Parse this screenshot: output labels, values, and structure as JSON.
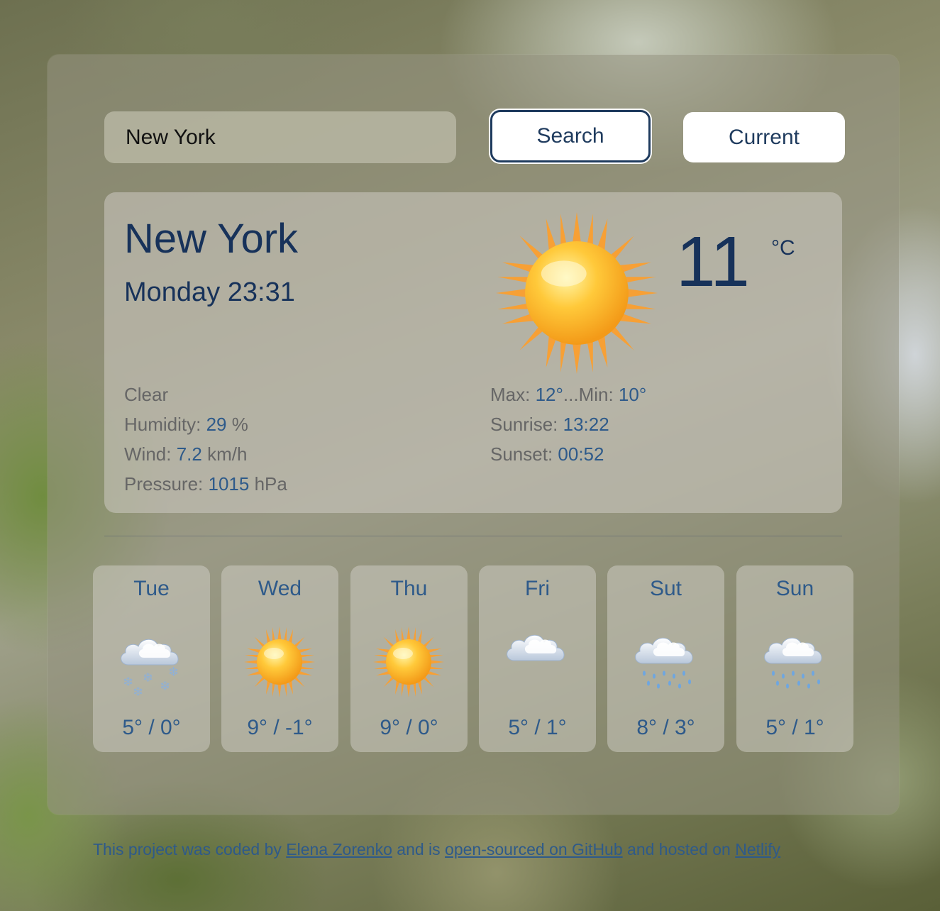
{
  "search": {
    "value": "New York",
    "search_label": "Search",
    "current_label": "Current"
  },
  "current": {
    "city": "New York",
    "datetime": "Monday 23:31",
    "description": "Clear",
    "humidity_label": "Humidity: ",
    "humidity_value": "29",
    "humidity_unit": " %",
    "wind_label": "Wind: ",
    "wind_value": "7.2",
    "wind_unit": " km/h",
    "pressure_label": "Pressure: ",
    "pressure_value": "1015",
    "pressure_unit": " hPa",
    "max_label": "Max: ",
    "max_value": "12°",
    "min_label": "...Min: ",
    "min_value": "10°",
    "sunrise_label": "Sunrise: ",
    "sunrise_value": "13:22",
    "sunset_label": "Sunset: ",
    "sunset_value": "00:52",
    "temperature": "11",
    "unit": "°C",
    "icon": "sun-icon"
  },
  "forecast": [
    {
      "day": "Tue",
      "temps": "5° / 0°",
      "icon": "snow-icon"
    },
    {
      "day": "Wed",
      "temps": "9° / -1°",
      "icon": "sun-icon"
    },
    {
      "day": "Thu",
      "temps": "9° / 0°",
      "icon": "sun-icon"
    },
    {
      "day": "Fri",
      "temps": "5° / 1°",
      "icon": "cloud-icon"
    },
    {
      "day": "Sut",
      "temps": "8° / 3°",
      "icon": "rain-icon"
    },
    {
      "day": "Sun",
      "temps": "5° / 1°",
      "icon": "rain-icon"
    }
  ],
  "footer": {
    "t1": "This project was coded by ",
    "author": "Elena Zorenko",
    "t2": " and is ",
    "github": "open-sourced on GitHub",
    "t3": " and hosted on ",
    "netlify": "Netlify"
  }
}
